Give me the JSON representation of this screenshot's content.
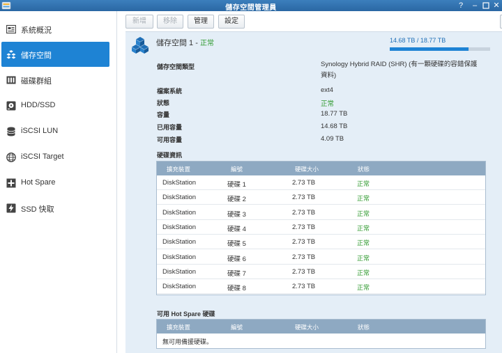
{
  "window": {
    "title": "儲存空間管理員",
    "help_icon": "help-icon",
    "minimize_icon": "minimize-icon",
    "maximize_icon": "maximize-icon",
    "close_icon": "close-icon"
  },
  "sidebar": {
    "items": [
      {
        "label": "系統概況",
        "icon": "overview-icon"
      },
      {
        "label": "儲存空間",
        "icon": "volume-icon"
      },
      {
        "label": "磁碟群組",
        "icon": "diskgroup-icon"
      },
      {
        "label": "HDD/SSD",
        "icon": "hdd-icon"
      },
      {
        "label": "iSCSI LUN",
        "icon": "iscsi-lun-icon"
      },
      {
        "label": "iSCSI Target",
        "icon": "iscsi-target-icon"
      },
      {
        "label": "Hot Spare",
        "icon": "hot-spare-icon"
      },
      {
        "label": "SSD 快取",
        "icon": "ssd-cache-icon"
      }
    ]
  },
  "toolbar": {
    "new_label": "新增",
    "remove_label": "移除",
    "manage_label": "管理",
    "settings_label": "設定"
  },
  "volume": {
    "title": "儲存空間 1",
    "separator": " - ",
    "status": "正常",
    "capacity_text": "14.68 TB / 18.77 TB",
    "used_fraction": 0.782,
    "colors": {
      "accent": "#1e83d4",
      "ok": "#2f9a2f",
      "header": "#8ea9c2",
      "panel": "#e4eef7"
    }
  },
  "properties": [
    {
      "label": "儲存空間類型",
      "value": "Synology Hybrid RAID (SHR) (有一顆硬碟的容錯保護資料)"
    },
    {
      "label": "檔案系統",
      "value": "ext4"
    },
    {
      "label": "狀態",
      "value": "正常"
    },
    {
      "label": "容量",
      "value": "18.77 TB"
    },
    {
      "label": "已用容量",
      "value": "14.68 TB"
    },
    {
      "label": "可用容量",
      "value": "4.09 TB"
    }
  ],
  "disk_info": {
    "title": "硬碟資訊",
    "columns": [
      "擴充裝置",
      "編號",
      "硬碟大小",
      "狀態"
    ],
    "rows": [
      [
        "DiskStation",
        "硬碟 1",
        "2.73 TB",
        "正常"
      ],
      [
        "DiskStation",
        "硬碟 2",
        "2.73 TB",
        "正常"
      ],
      [
        "DiskStation",
        "硬碟 3",
        "2.73 TB",
        "正常"
      ],
      [
        "DiskStation",
        "硬碟 4",
        "2.73 TB",
        "正常"
      ],
      [
        "DiskStation",
        "硬碟 5",
        "2.73 TB",
        "正常"
      ],
      [
        "DiskStation",
        "硬碟 6",
        "2.73 TB",
        "正常"
      ],
      [
        "DiskStation",
        "硬碟 7",
        "2.73 TB",
        "正常"
      ],
      [
        "DiskStation",
        "硬碟 8",
        "2.73 TB",
        "正常"
      ]
    ]
  },
  "hot_spare": {
    "title": "可用 Hot Spare 硬碟",
    "columns": [
      "擴充裝置",
      "編號",
      "硬碟大小",
      "狀態"
    ],
    "empty_text": "無可用備援硬碟。"
  }
}
